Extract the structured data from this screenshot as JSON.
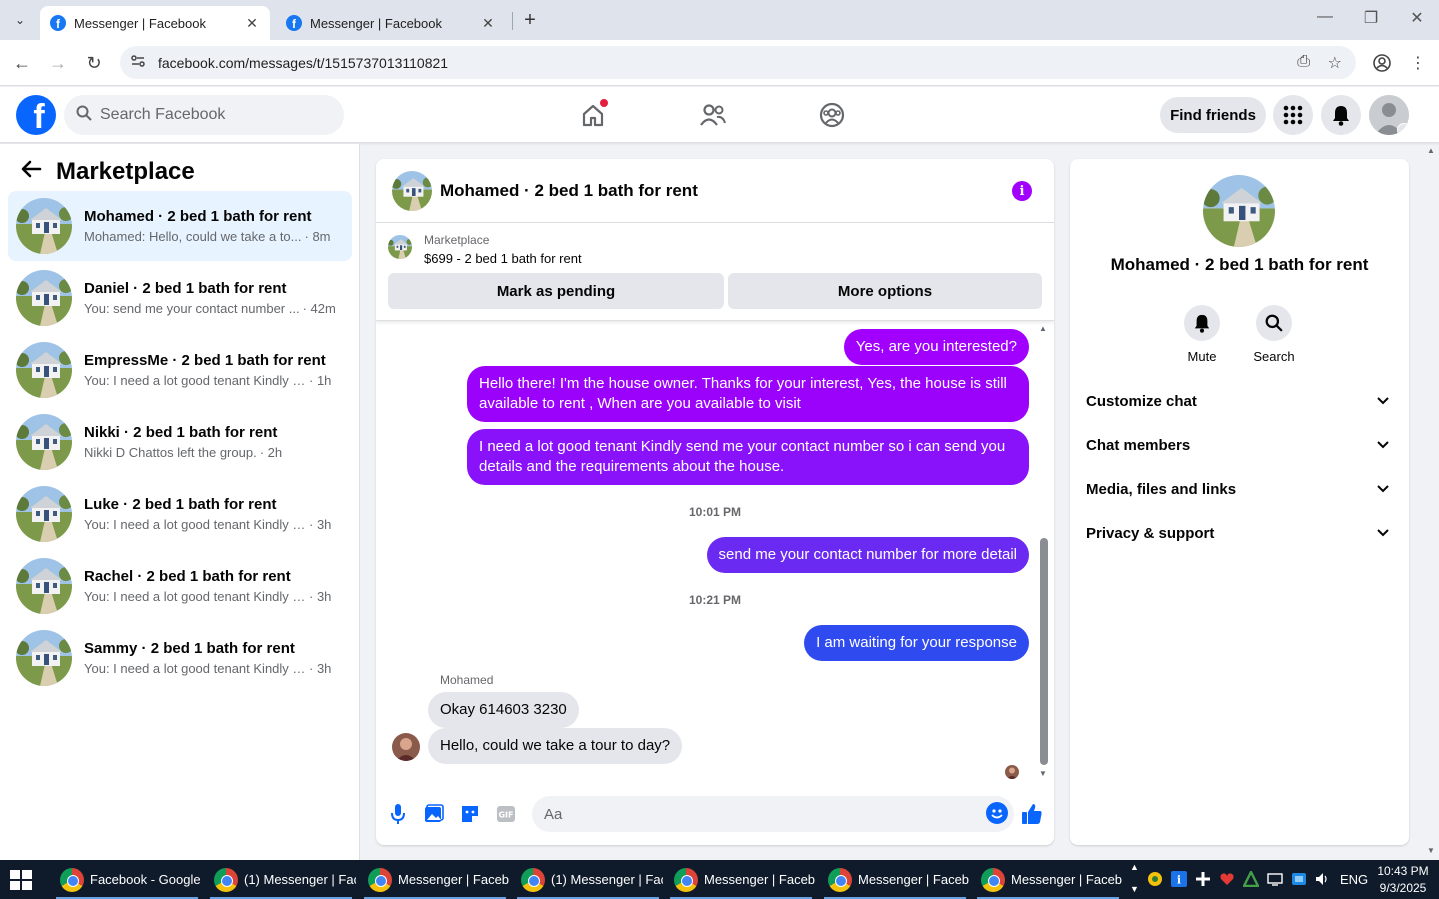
{
  "browser": {
    "tabs": [
      {
        "title": "Messenger | Facebook",
        "active": true
      },
      {
        "title": "Messenger | Facebook",
        "active": false
      }
    ],
    "url": "facebook.com/messages/t/1515737013110821"
  },
  "fb_header": {
    "search_placeholder": "Search Facebook",
    "find_friends": "Find friends"
  },
  "sidebar": {
    "title": "Marketplace",
    "conversations": [
      {
        "name": "Mohamed · 2 bed 1 bath for rent",
        "preview": "Mohamed: Hello, could we take a to...",
        "time": "· 8m",
        "active": true
      },
      {
        "name": "Daniel · 2 bed 1 bath for rent",
        "preview": "You: send me your contact number ...",
        "time": "· 42m",
        "active": false
      },
      {
        "name": "EmpressMe · 2 bed 1 bath for rent",
        "preview": "You: I need a lot good tenant Kindly s...",
        "time": "· 1h",
        "active": false
      },
      {
        "name": "Nikki · 2 bed 1 bath for rent",
        "preview": "Nikki D Chattos left the group.",
        "time": "· 2h",
        "active": false
      },
      {
        "name": "Luke · 2 bed 1 bath for rent",
        "preview": "You: I need a lot good tenant Kindly s...",
        "time": "· 3h",
        "active": false
      },
      {
        "name": "Rachel · 2 bed 1 bath for rent",
        "preview": "You: I need a lot good tenant Kindly s...",
        "time": "· 3h",
        "active": false
      },
      {
        "name": "Sammy · 2 bed 1 bath for rent",
        "preview": "You: I need a lot good tenant Kindly s...",
        "time": "· 3h",
        "active": false
      }
    ]
  },
  "chat": {
    "title": "Mohamed · 2 bed 1 bath for rent",
    "marketplace_label": "Marketplace",
    "listing": "$699 - 2 bed 1 bath for rent",
    "mark_pending": "Mark as pending",
    "more_options": "More options",
    "messages": [
      {
        "from": "me",
        "text": "Yes, are you interested?"
      },
      {
        "from": "me",
        "text": "Hello there! I'm the house owner. Thanks for your interest, Yes, the house is still available to rent , When are you available to visit"
      },
      {
        "from": "me",
        "text": "I need a lot good tenant Kindly send me your contact number so i can send you details and the requirements about the house."
      },
      {
        "from": "me",
        "text": "send me your contact number for more detail"
      },
      {
        "from": "me",
        "text": "I am waiting for your response"
      },
      {
        "from": "them",
        "text": "Okay 614603 3230"
      },
      {
        "from": "them",
        "text": "Hello, could we take a tour to day?"
      }
    ],
    "timestamps": [
      "10:01 PM",
      "10:21 PM"
    ],
    "sender_name": "Mohamed",
    "composer_placeholder": "Aa",
    "colors": {
      "purple": "#a100ff",
      "violet": "#7b1fff",
      "blue": "#2f4bf0"
    }
  },
  "right_panel": {
    "name": "Mohamed · 2 bed 1 bath for rent",
    "actions": [
      {
        "label": "Mute",
        "icon": "bell-icon"
      },
      {
        "label": "Search",
        "icon": "search-icon"
      }
    ],
    "sections": [
      "Customize chat",
      "Chat members",
      "Media, files and links",
      "Privacy & support"
    ]
  },
  "taskbar": {
    "items": [
      "Facebook - Google ...",
      "(1) Messenger | Fac...",
      "Messenger | Faceb...",
      "(1) Messenger | Fac...",
      "Messenger | Faceb...",
      "Messenger | Faceb...",
      "Messenger | Faceb..."
    ],
    "lang": "ENG",
    "time": "10:43 PM",
    "date": "9/3/2025"
  }
}
